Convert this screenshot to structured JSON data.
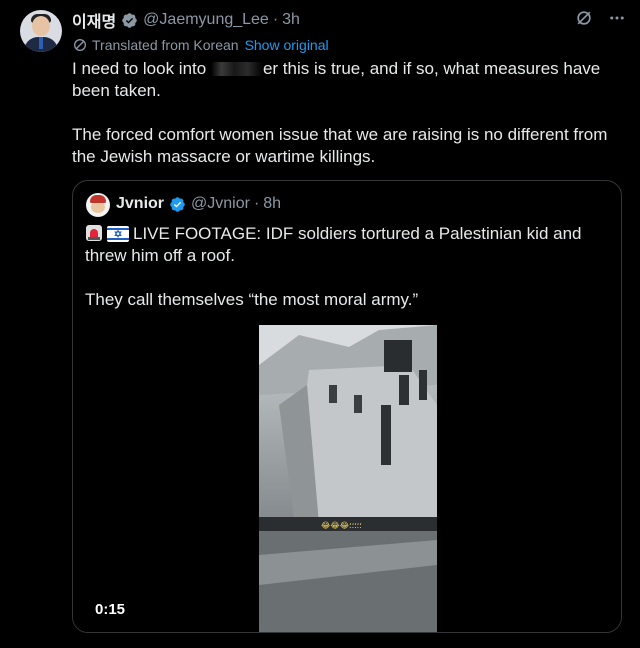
{
  "tweet": {
    "author_name": "이재명",
    "author_handle": "@Jaemyung_Lee",
    "separator": "·",
    "time": "3h",
    "translated_label": "Translated from Korean",
    "show_original_label": "Show original",
    "text_part1": "I need to look into ",
    "text_part1b": "er this is true, and if so, what measures have been taken.",
    "text_part2": "The forced comfort women issue that we are raising is no different from the Jewish massacre or wartime killings."
  },
  "quoted_tweet": {
    "author_name": "Jvnior",
    "author_handle": "@Jvnior",
    "separator": "·",
    "time": "8h",
    "text_line1": "LIVE FOOTAGE: IDF soldiers tortured a Palestinian kid and threw him off a roof.",
    "text_line2": "They call themselves “the most moral army.”",
    "video_duration": "0:15",
    "video_caption": "😂😂😂؛؛؛؛؛"
  },
  "icons": {
    "verified": "verified-badge-icon",
    "translate": "translate-icon",
    "grok": "grok-icon",
    "more": "more-options-icon",
    "rotating_light": "rotating-light-emoji",
    "israel_flag": "israel-flag-emoji"
  },
  "colors": {
    "background": "#000000",
    "text": "#e7e9ea",
    "secondary": "#8b98a5",
    "link": "#1d9bf0",
    "border": "#333639"
  }
}
